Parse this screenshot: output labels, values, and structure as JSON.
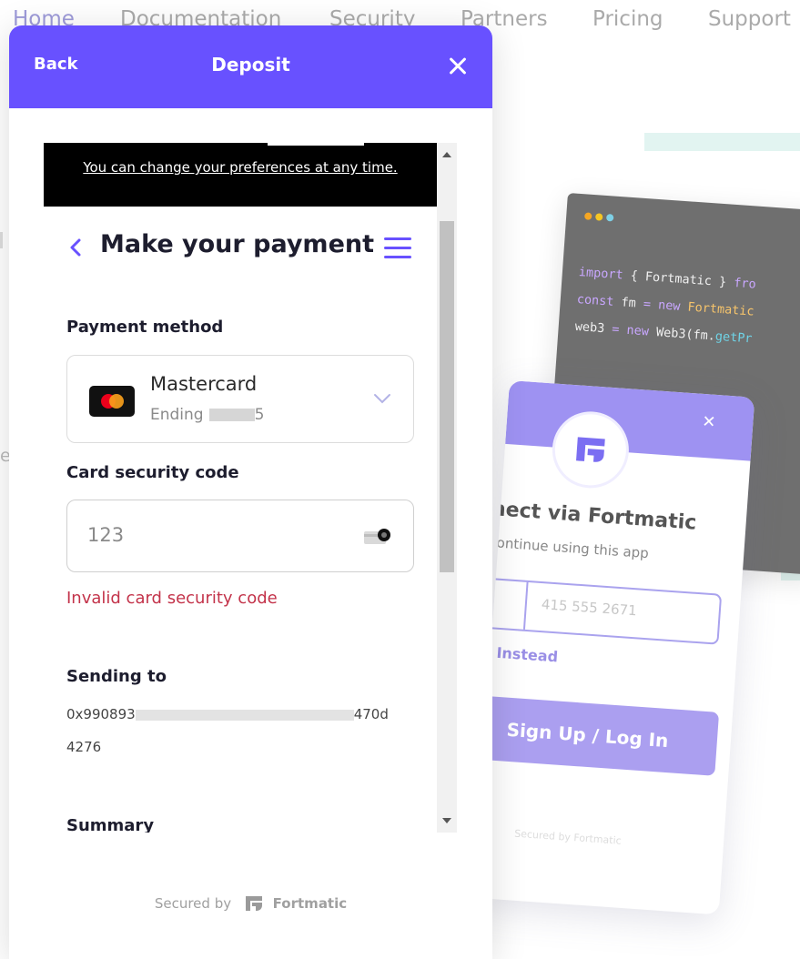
{
  "background": {
    "nav": [
      "Home",
      "Documentation",
      "Security",
      "Partners",
      "Pricing",
      "Support"
    ],
    "code_lines": {
      "line1": [
        "import",
        "{ Fortmatic }",
        "fro"
      ],
      "line2": [
        "const",
        "fm",
        "=",
        "new",
        "Fortmatic"
      ],
      "line3": [
        "web3",
        "=",
        "new",
        "Web3(fm.",
        "getPr"
      ]
    },
    "fm_widget": {
      "title": "nect via Fortmatic",
      "subtitle": "continue using this app",
      "phone_placeholder": "415 555 2671",
      "email_link": "il Instead",
      "button": "Sign Up / Log In",
      "secured": "Secured by",
      "brand": "Fortmatic"
    },
    "stray_text": "e"
  },
  "modal": {
    "back_label": "Back",
    "title": "Deposit",
    "cookie_link": "You can change your preferences at any time.",
    "page_title": "Make your payment",
    "payment_method_label": "Payment method",
    "card": {
      "name": "Mastercard",
      "ending_label": "Ending",
      "ending_suffix": "5"
    },
    "cvc_label": "Card security code",
    "cvc_placeholder": "123",
    "cvc_error": "Invalid card security code",
    "sending_to_label": "Sending to",
    "address_start": "0x990893",
    "address_end": "470d",
    "address_line2": "4276",
    "summary_label": "Summary",
    "secured_label": "Secured by",
    "brand": "Fortmatic"
  },
  "colors": {
    "brand_purple": "#6851ff",
    "error_red": "#c3334a"
  },
  "icons": {
    "close": "close-icon",
    "back_chevron": "chevron-left-icon",
    "menu": "hamburger-menu-icon",
    "select": "chevron-down-icon",
    "card_brand": "mastercard-icon",
    "cvc": "card-cvc-icon",
    "brand": "fortmatic-logo-icon"
  }
}
